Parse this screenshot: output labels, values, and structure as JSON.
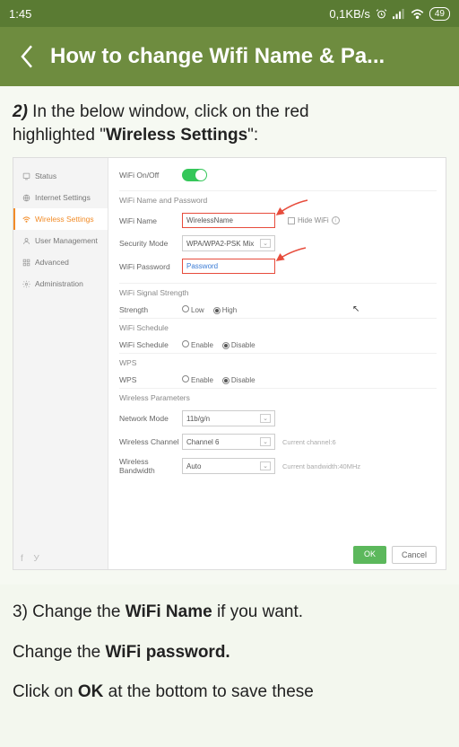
{
  "statusbar": {
    "time": "1:45",
    "net_speed": "0,1KB/s",
    "battery": "49"
  },
  "appbar": {
    "title": "How to change Wifi Name & Pa..."
  },
  "article": {
    "step2_prefix": "2)",
    "step2_line1": " In the below window, click on the red",
    "step2_line2_a": "highlighted \"",
    "step2_line2_b": "Wireless Settings",
    "step2_line2_c": "\":",
    "step3_a": "3) Change the ",
    "step3_b": "WiFi Name",
    "step3_c": " if you want.",
    "step4_a": "Change the ",
    "step4_b": "WiFi password.",
    "step5_a": "Click on  ",
    "step5_b": "OK",
    "step5_c": " at the bottom to save these"
  },
  "sidebar": {
    "items": [
      "Status",
      "Internet Settings",
      "Wireless Settings",
      "User Management",
      "Advanced",
      "Administration"
    ]
  },
  "panel": {
    "wifi_onoff": "WiFi On/Off",
    "sec_name_pw": "WiFi Name and Password",
    "wifi_name_lbl": "WiFi Name",
    "wifi_name_val": "WirelessName",
    "hide_wifi": "Hide WiFi",
    "sec_mode_lbl": "Security Mode",
    "sec_mode_val": "WPA/WPA2-PSK Mix",
    "wifi_pw_lbl": "WiFi Password",
    "wifi_pw_val": "Password",
    "sec_signal": "WiFi Signal Strength",
    "strength_lbl": "Strength",
    "strength_low": "Low",
    "strength_high": "High",
    "sec_schedule": "WiFi Schedule",
    "schedule_lbl": "WiFi Schedule",
    "enable": "Enable",
    "disable": "Disable",
    "sec_wps": "WPS",
    "wps_lbl": "WPS",
    "sec_params": "Wireless Parameters",
    "netmode_lbl": "Network Mode",
    "netmode_val": "11b/g/n",
    "channel_lbl": "Wireless Channel",
    "channel_val": "Channel 6",
    "channel_note": "Current channel:6",
    "bw_lbl": "Wireless Bandwidth",
    "bw_val": "Auto",
    "bw_note": "Current bandwidth:40MHz",
    "ok": "OK",
    "cancel": "Cancel"
  }
}
